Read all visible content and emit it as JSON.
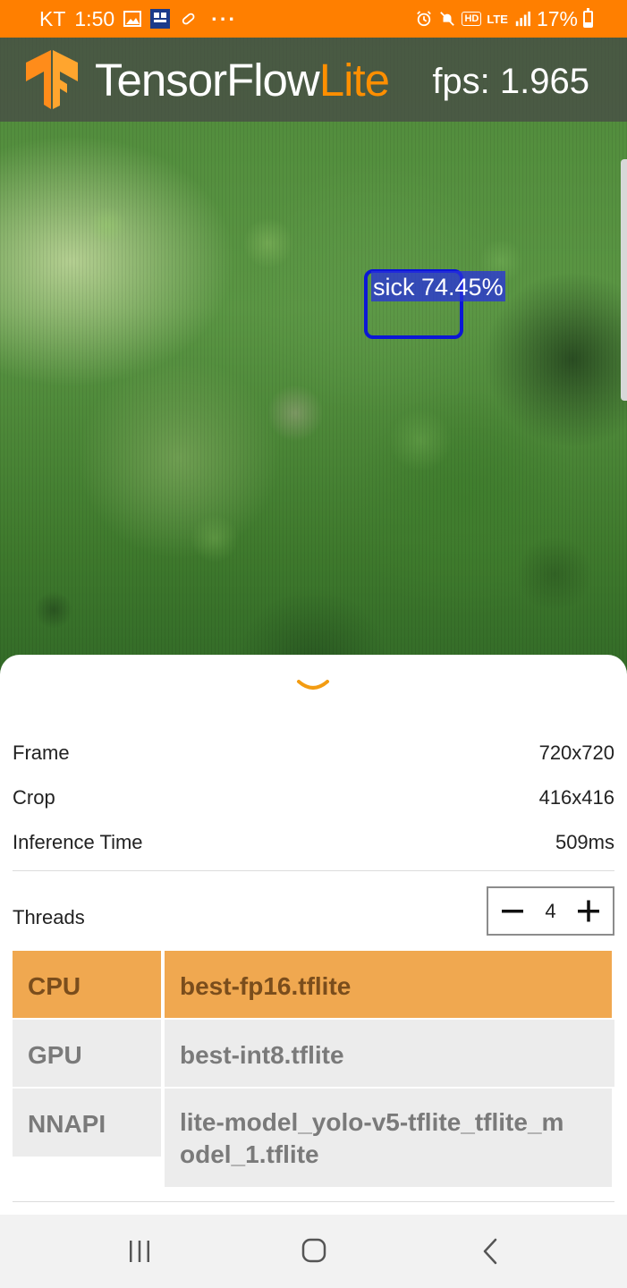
{
  "status_bar": {
    "carrier": "KT",
    "time": "1:50",
    "more": "···",
    "hd_badge": "HD",
    "network": "LTE",
    "battery": "17%",
    "icons": [
      "image-icon",
      "app-icon",
      "pill-icon",
      "alarm-icon",
      "mute-icon",
      "signal-icon",
      "battery-icon"
    ]
  },
  "app_bar": {
    "brand_main": "TensorFlow",
    "brand_accent": "Lite",
    "fps": "fps: 1.965"
  },
  "detection": {
    "label": "sick 74.45%"
  },
  "sheet": {
    "info": [
      {
        "label": "Frame",
        "value": "720x720"
      },
      {
        "label": "Crop",
        "value": "416x416"
      },
      {
        "label": "Inference Time",
        "value": "509ms"
      }
    ],
    "threads": {
      "label": "Threads",
      "value": "4"
    },
    "delegates": [
      {
        "label": "CPU",
        "selected": true
      },
      {
        "label": "GPU",
        "selected": false
      },
      {
        "label": "NNAPI",
        "selected": false
      }
    ],
    "models": [
      {
        "label": "best-fp16.tflite",
        "selected": true
      },
      {
        "label": "best-int8.tflite",
        "selected": false
      },
      {
        "label": "lite-model_yolo-v5-tflite_tflite_model_1.tflite",
        "selected": false
      }
    ]
  },
  "colors": {
    "status_bar": "#ff7f00",
    "brand_accent": "#ff8f00",
    "selection": "#f0a850",
    "detection_box": "#0c17d6"
  }
}
